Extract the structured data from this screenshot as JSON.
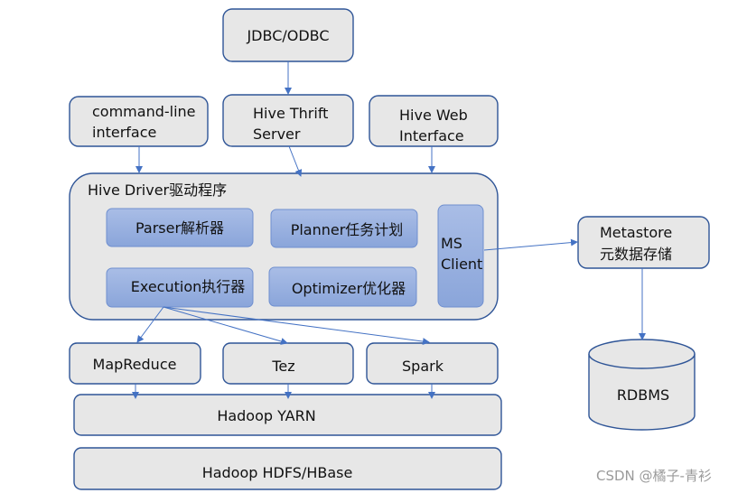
{
  "nodes": {
    "jdbc": "JDBC/ODBC",
    "cli": [
      "command-line",
      "interface"
    ],
    "thrift": [
      "Hive Thrift",
      "Server"
    ],
    "web": [
      "Hive Web",
      "Interface"
    ],
    "driver": "Hive Driver驱动程序",
    "parser": "Parser解析器",
    "planner": "Planner任务计划",
    "ms_client": [
      "MS",
      "Client"
    ],
    "execution": "Execution执行器",
    "optimizer": "Optimizer优化器",
    "mapreduce": "MapReduce",
    "tez": "Tez",
    "spark": "Spark",
    "yarn": "Hadoop YARN",
    "hdfs": "Hadoop HDFS/HBase",
    "metastore": [
      "Metastore",
      "元数据存储"
    ],
    "rdbms": "RDBMS"
  },
  "watermark": "CSDN @橘子-青衫",
  "colors": {
    "border": "#2f5597",
    "box_fill": "#e7e7e7",
    "inner_fill": "#8faadc",
    "arrow": "#4472c4"
  }
}
